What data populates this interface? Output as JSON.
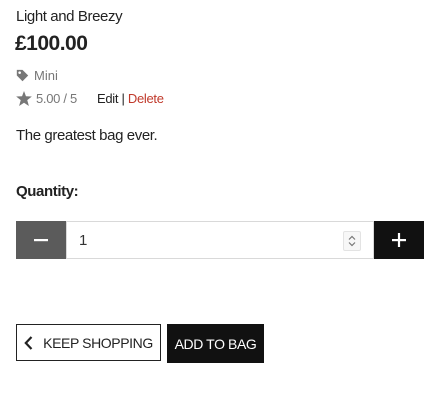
{
  "product": {
    "name": "Light and Breezy",
    "price": "£100.00",
    "category": "Mini",
    "rating": "5.00 / 5",
    "edit_label": "Edit",
    "separator": "|",
    "delete_label": "Delete",
    "description": "The greatest bag ever."
  },
  "quantity": {
    "label": "Quantity:",
    "value": "1"
  },
  "actions": {
    "keep_shopping_label": "KEEP SHOPPING",
    "add_to_bag_label": "ADD TO BAG"
  },
  "icons": {
    "tag": "tag-icon",
    "star": "star-icon",
    "minus": "minus-icon",
    "plus": "plus-icon",
    "back": "chevron-left-icon"
  },
  "colors": {
    "delete_link": "#c0392b",
    "minus_button": "#5b5b5b",
    "plus_button": "#111111",
    "primary_button": "#111111"
  }
}
